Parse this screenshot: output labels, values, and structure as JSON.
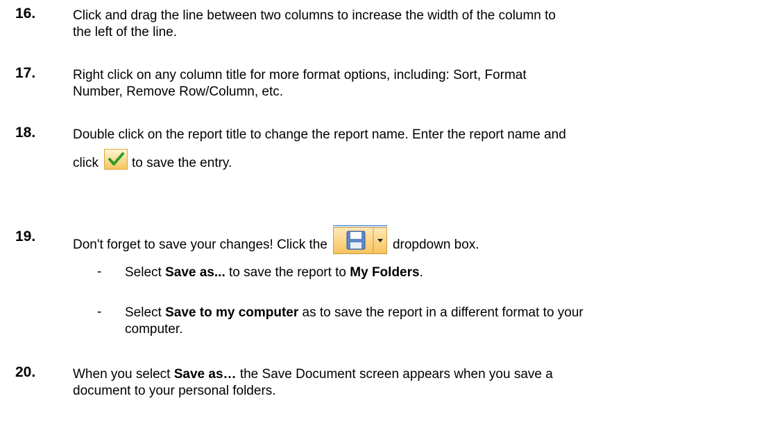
{
  "steps": [
    {
      "number": "16.",
      "lines": [
        "Click and drag the line between two columns to increase the width of the column to",
        "the left of the line."
      ]
    },
    {
      "number": "17.",
      "lines": [
        "Right click on any column title for more format options, including: Sort, Format",
        "Number, Remove Row/Column, etc."
      ]
    },
    {
      "number": "18.",
      "line1": "Double click on the report title to change the report name.  Enter the report name and",
      "click_pre": "click",
      "click_post": "to save the entry."
    },
    {
      "number": "19.",
      "pre": "Don't forget to save your changes!  Click the",
      "post": "dropdown box."
    },
    {
      "number": "20.",
      "pre": "When you select",
      "bold": "Save as…",
      "post": "the Save Document screen appears when you save a",
      "line2": "document to your personal folders."
    }
  ],
  "bullets": [
    {
      "dash": "-",
      "pre": "Select",
      "bold1": "Save as...",
      "mid": "to save the report to",
      "bold2": "My Folders",
      "post": "."
    },
    {
      "dash": "-",
      "pre": "Select",
      "bold1": "Save to my computer",
      "mid": "as to save the report in a different format to your",
      "line2": "computer."
    }
  ],
  "icons": {
    "check": "checkmark-icon",
    "save": "save-dropdown-icon"
  }
}
